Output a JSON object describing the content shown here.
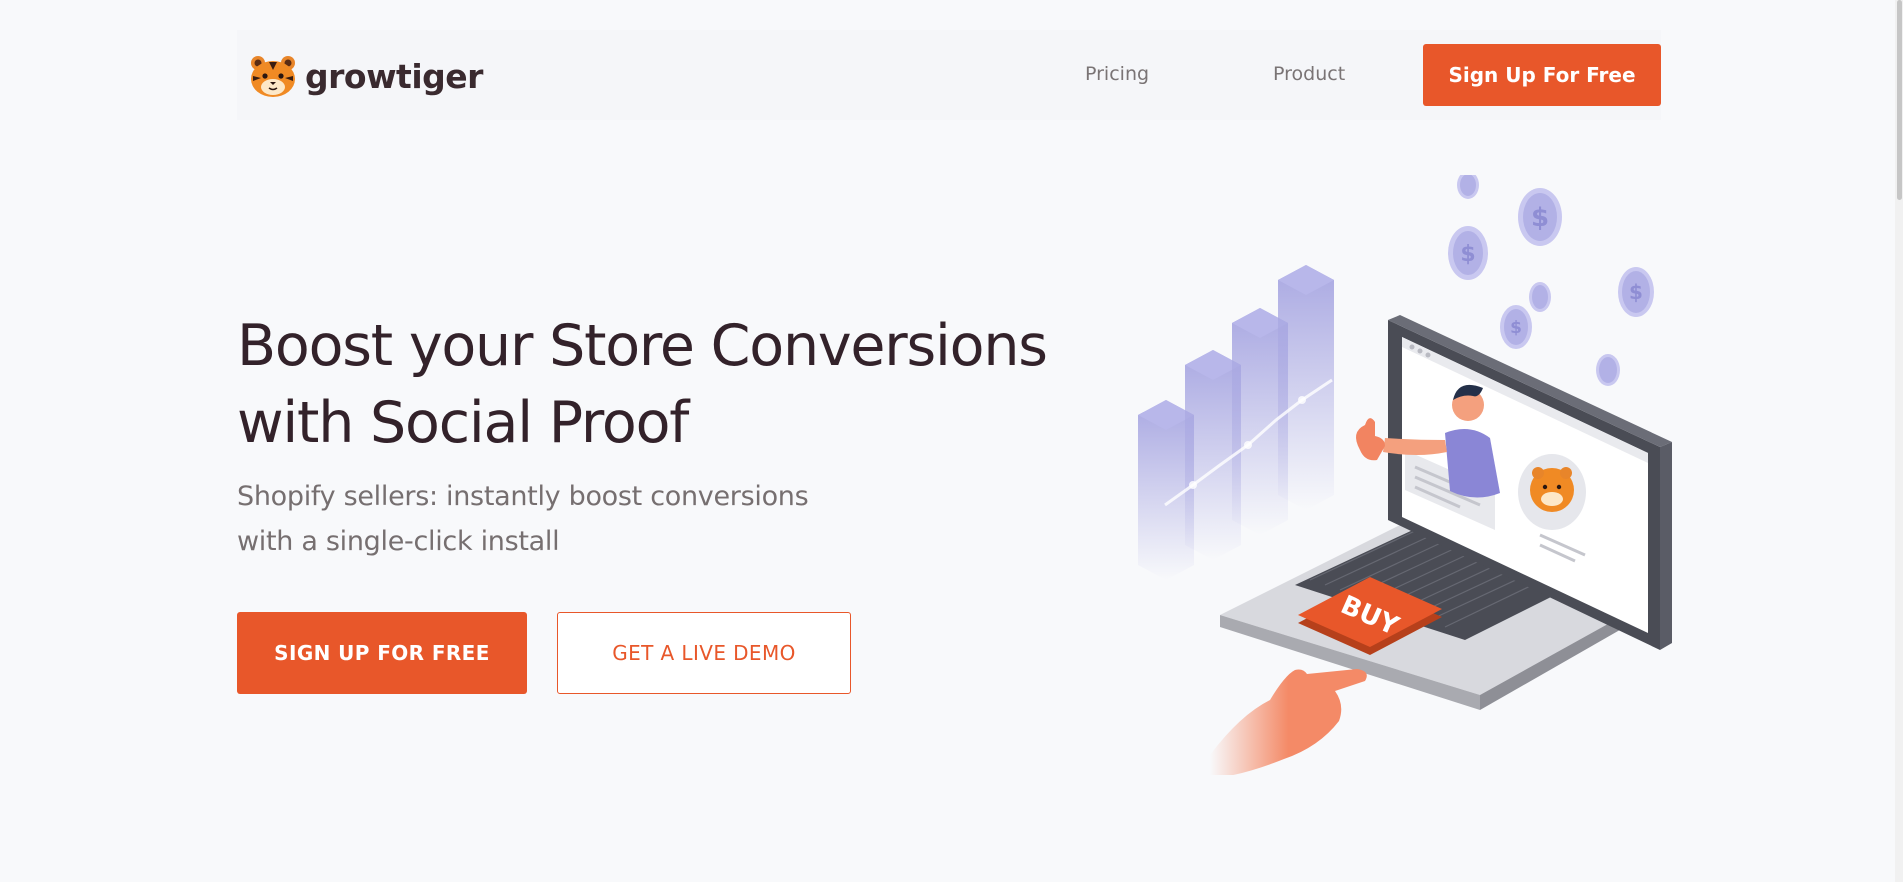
{
  "header": {
    "logo_text": "growtiger",
    "nav": [
      {
        "label": "Pricing"
      },
      {
        "label": "Product"
      }
    ],
    "cta_label": "Sign Up For Free"
  },
  "hero": {
    "title_line1": "Boost your Store Conversions",
    "title_line2": "with Social Proof",
    "subtitle_line1": "Shopify sellers: instantly boost conversions",
    "subtitle_line2": "with a single-click install",
    "primary_button": "SIGN UP FOR FREE",
    "secondary_button": "GET A LIVE DEMO"
  },
  "illustration": {
    "buy_label": "BUY",
    "coin_symbol": "$"
  },
  "colors": {
    "accent": "#e8572a",
    "heading": "#33222a",
    "muted": "#766f70",
    "background": "#f8f9fb",
    "chart_purple": "#a5a4df"
  }
}
